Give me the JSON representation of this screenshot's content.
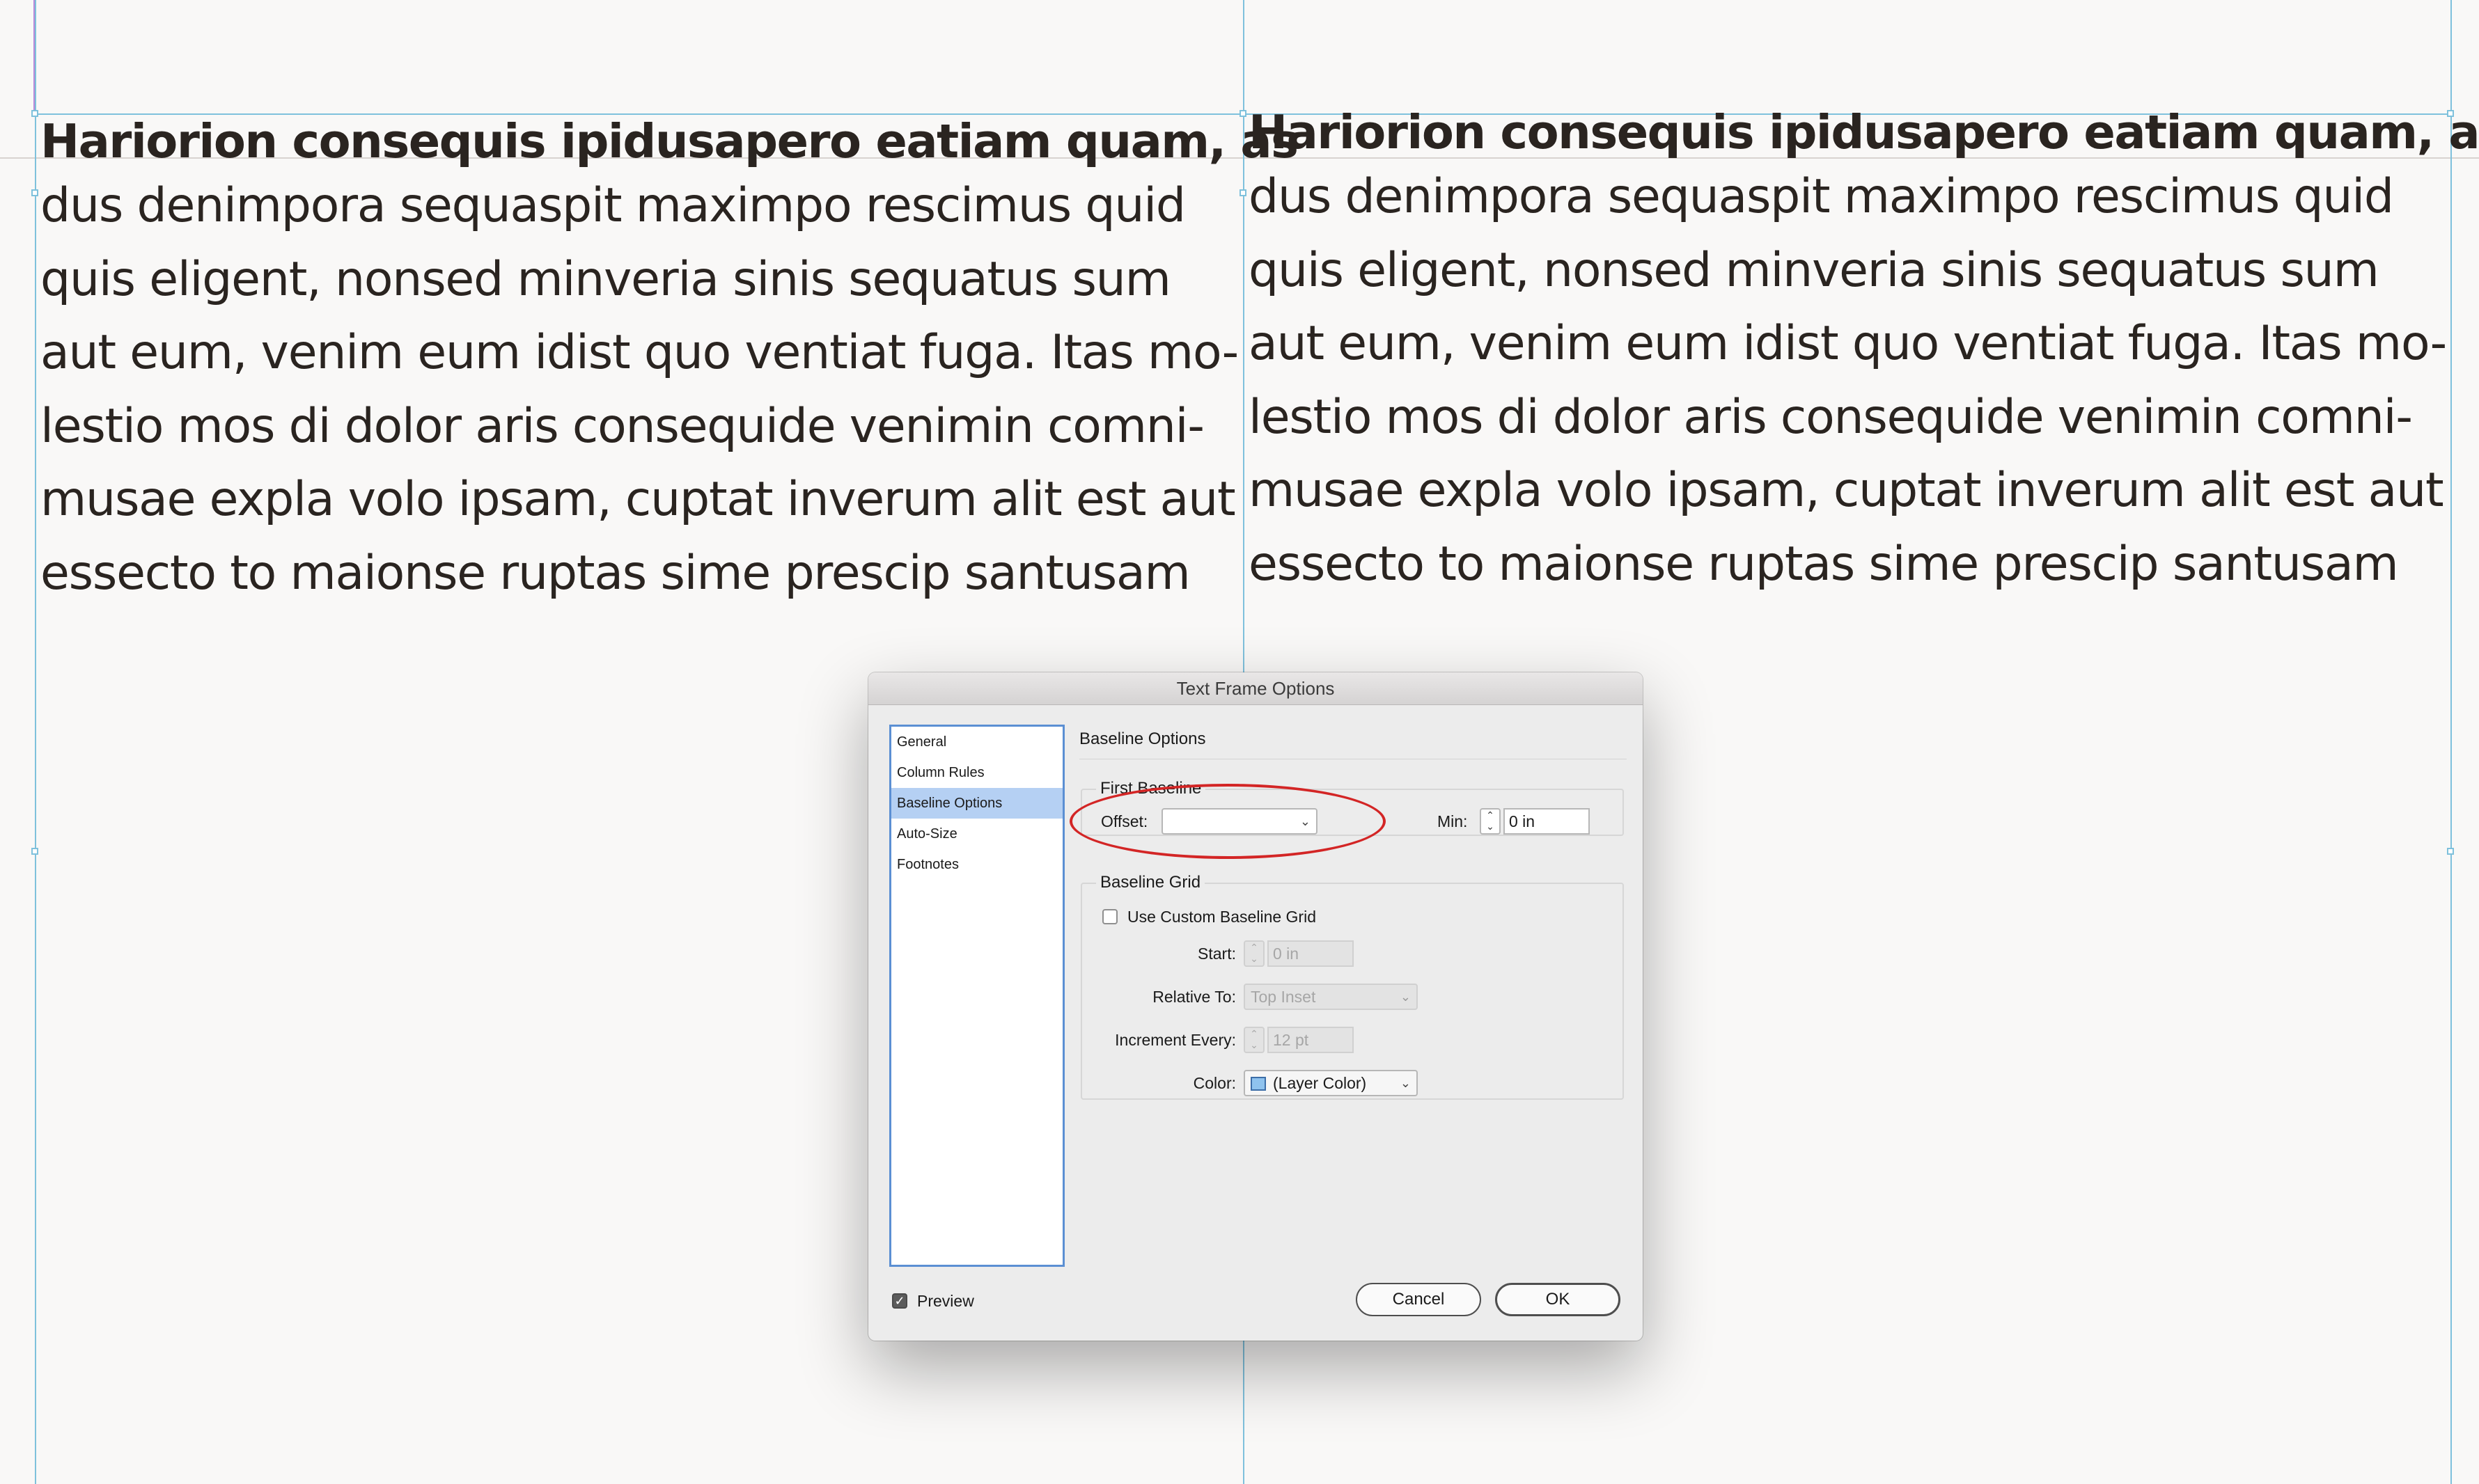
{
  "document": {
    "frames": [
      {
        "heading": "Hariorion consequis ipidusapero eatiam quam, as",
        "lines": [
          "dus denimpora sequaspit maximpo rescimus quid",
          "quis eligent, nonsed minveria sinis sequatus sum",
          "aut eum, venim eum idist quo ventiat fuga. Itas mo-",
          "lestio mos di dolor aris consequide venimin comni-",
          "musae expla volo ipsam, cuptat inverum alit est aut",
          "essecto to maionse ruptas sime prescip santusam"
        ]
      },
      {
        "heading": "Hariorion consequis ipidusapero eatiam quam, as",
        "lines": [
          "dus denimpora sequaspit maximpo rescimus quid",
          "quis eligent, nonsed minveria sinis sequatus sum",
          "aut eum, venim eum idist quo ventiat fuga. Itas mo-",
          "lestio mos di dolor aris consequide venimin comni-",
          "musae expla volo ipsam, cuptat inverum alit est aut",
          "essecto to maionse ruptas sime prescip santusam"
        ]
      }
    ]
  },
  "dialog": {
    "title": "Text Frame Options",
    "sidebar": {
      "items": [
        {
          "label": "General"
        },
        {
          "label": "Column Rules"
        },
        {
          "label": "Baseline Options",
          "selected": true
        },
        {
          "label": "Auto-Size"
        },
        {
          "label": "Footnotes"
        }
      ]
    },
    "section_title": "Baseline Options",
    "first_baseline": {
      "label": "First Baseline",
      "offset_label": "Offset:",
      "offset_value": "",
      "min_label": "Min:",
      "min_value": "0 in"
    },
    "baseline_grid": {
      "label": "Baseline Grid",
      "use_custom_label": "Use Custom Baseline Grid",
      "use_custom_checked": false,
      "start_label": "Start:",
      "start_value": "0 in",
      "relative_to_label": "Relative To:",
      "relative_to_value": "Top Inset",
      "increment_label": "Increment Every:",
      "increment_value": "12 pt",
      "color_label": "Color:",
      "color_value": "(Layer Color)",
      "color_swatch": "#8fc3ee"
    },
    "preview": {
      "label": "Preview",
      "checked": true
    },
    "buttons": {
      "cancel": "Cancel",
      "ok": "OK"
    }
  },
  "colors": {
    "guide": "#7fc1dc",
    "selection": "#b5d0f3",
    "annotation": "#d32525"
  }
}
